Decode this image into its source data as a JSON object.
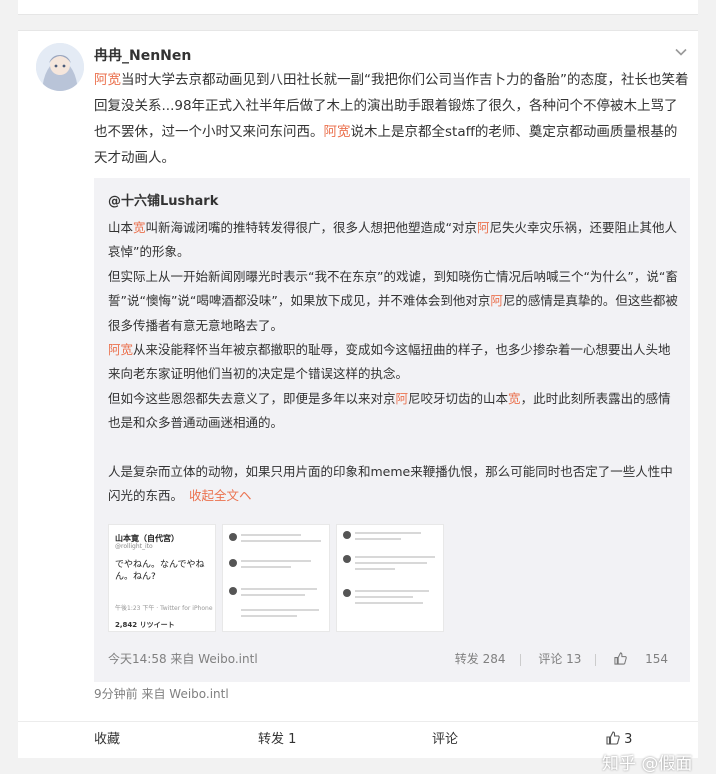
{
  "post": {
    "username": "冉冉_NenNen",
    "segments": [
      {
        "text": "阿宽",
        "hl": true
      },
      {
        "text": "当时大学去京都动画见到八田社长就一副“我把你们公司当作吉卜力的备胎”的态度，社长也笑着回复没关系...98年正式入社半年后做了木上的演出助手跟着锻炼了很久，各种问个不停被木上骂了也不罢休，过一个小时又来问东问西。",
        "hl": false
      },
      {
        "text": "阿宽",
        "hl": true
      },
      {
        "text": "说木上是京都全staff的老师、奠定京都动画质量根基的天才动画人。",
        "hl": false
      }
    ],
    "time_ago": "9分钟前",
    "source": "来自 Weibo.intl"
  },
  "repost": {
    "author": "@十六铺Lushark",
    "paragraphs": [
      [
        {
          "text": "山本"
        },
        {
          "text": "宽",
          "hl": true
        },
        {
          "text": "叫新海诚闭嘴的推特转发得很广，很多人想把他塑造成“对京"
        },
        {
          "text": "阿",
          "hl": true
        },
        {
          "text": "尼失火幸灾乐祸，还要阻止其他人哀悼”的形象。"
        }
      ],
      [
        {
          "text": "但实际上从一开始新闻刚曝光时表示“我不在东京”的戏谑，到知晓伤亡情况后呐喊三个“为什么”，说“畜誓”说“懊悔”说“喝啤酒都没味”，如果放下成见，并不难体会到他对京"
        },
        {
          "text": "阿",
          "hl": true
        },
        {
          "text": "尼的感情是真挚的。但这些都被很多传播者有意无意地略去了。"
        }
      ],
      [
        {
          "text": "阿宽",
          "hl": true
        },
        {
          "text": "从来没能释怀当年被京都撤职的耻辱，变成如今这幅扭曲的样子，也多少掺杂着一心想要出人头地来向老东家证明他们当初的决定是个错误这样的执念。"
        }
      ],
      [
        {
          "text": "但如今这些恩怨都失去意义了，即便是多年以来对京"
        },
        {
          "text": "阿",
          "hl": true
        },
        {
          "text": "尼咬牙切齿的山本"
        },
        {
          "text": "宽",
          "hl": true
        },
        {
          "text": "，此时此刻所表露出的感情也是和众多普通动画迷相通的。"
        }
      ],
      [],
      [
        {
          "text": "人是复杂而立体的动物，如果只用片面的印象和meme来鞭播仇恨，那么可能同时也否定了一些人性中闪光的东西。"
        }
      ]
    ],
    "fold_link": "收起全文ヘ",
    "thumb1": {
      "name": "山本寛（自代宮）",
      "handle": "@rollight_ito",
      "text": "でやねん。なんでやねん。ねん?",
      "meta": "午後1:23 下午 · Twitter for iPhone",
      "count": "2,842 リツイート"
    },
    "time": "今天14:58",
    "source": "来自 Weibo.intl",
    "actions": {
      "repost": "转发 284",
      "comment": "评论 13",
      "like": "154"
    }
  },
  "bar": {
    "favorite": "收藏",
    "repost": "转发 1",
    "comment": "评论",
    "like": "3"
  },
  "watermark": "知乎 @假面",
  "colors": {
    "accent": "#eb7350",
    "repost_bg": "#f2f2f5"
  }
}
